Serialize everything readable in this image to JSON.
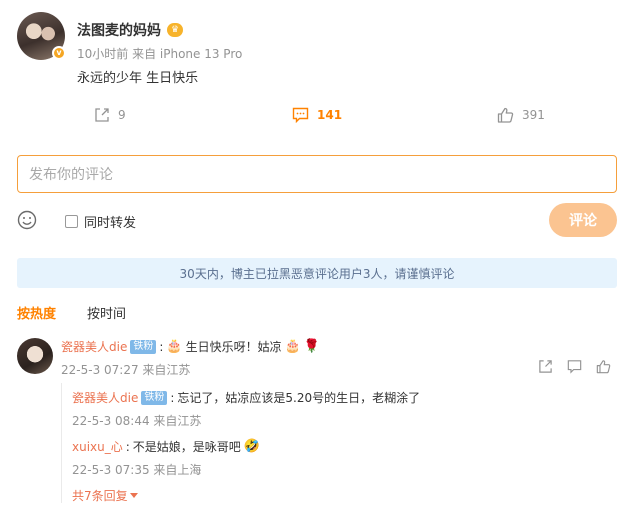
{
  "post": {
    "username": "法图麦的妈妈",
    "meta": "10小时前  来自 iPhone 13 Pro",
    "text": "永远的少年 生日快乐"
  },
  "actions": {
    "share_count": "9",
    "comment_count": "141",
    "like_count": "391"
  },
  "composer": {
    "placeholder": "发布你的评论",
    "repost_label": "同时转发",
    "submit_label": "评论"
  },
  "notice": "30天内，博主已拉黑恶意评论用户3人，请谨慎评论",
  "sort_tabs": [
    "按热度",
    "按时间"
  ],
  "comment": {
    "username": "瓷器美人die",
    "badge": "铁粉",
    "text": "生日快乐呀！姑凉",
    "meta": "22-5-3 07:27 来自江苏"
  },
  "replies": [
    {
      "username": "瓷器美人die",
      "badge": "铁粉",
      "text": "忘记了，姑凉应该是5.20号的生日，老糊涂了",
      "meta": "22-5-3 08:44 来自江苏"
    },
    {
      "username": "xuixu_心",
      "text": "不是姑娘，是咏哥吧",
      "meta": "22-5-3 07:35 来自上海"
    }
  ],
  "more_replies": "共7条回复",
  "colors": {
    "accent": "#ff8200",
    "name": "#eb7350",
    "notice_bg": "#e6f3fd",
    "fan_badge": "#7fb8e8",
    "submit_disabled": "#fbc491"
  }
}
